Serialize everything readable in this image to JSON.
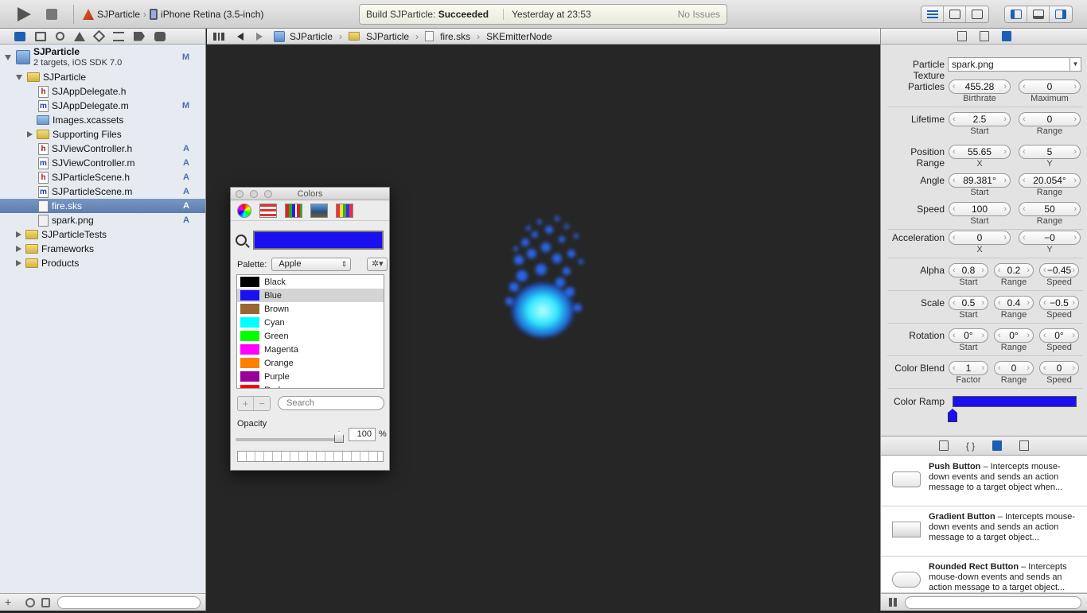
{
  "toolbar": {
    "project": "SJParticle",
    "destination": "iPhone Retina (3.5-inch)",
    "status_prefix": "Build SJParticle:",
    "status_result": "Succeeded",
    "status_time": "Yesterday at 23:53",
    "issues": "No Issues"
  },
  "navigator": {
    "project_name": "SJParticle",
    "project_sub": "2 targets, iOS SDK 7.0",
    "project_badge": "M",
    "rows": [
      {
        "label": "SJParticle",
        "badge": ""
      },
      {
        "label": "SJAppDelegate.h",
        "badge": ""
      },
      {
        "label": "SJAppDelegate.m",
        "badge": "M"
      },
      {
        "label": "Images.xcassets",
        "badge": ""
      },
      {
        "label": "Supporting Files",
        "badge": ""
      },
      {
        "label": "SJViewController.h",
        "badge": "A"
      },
      {
        "label": "SJViewController.m",
        "badge": "A"
      },
      {
        "label": "SJParticleScene.h",
        "badge": "A"
      },
      {
        "label": "SJParticleScene.m",
        "badge": "A"
      },
      {
        "label": "fire.sks",
        "badge": "A"
      },
      {
        "label": "spark.png",
        "badge": "A"
      },
      {
        "label": "SJParticleTests",
        "badge": ""
      },
      {
        "label": "Frameworks",
        "badge": ""
      },
      {
        "label": "Products",
        "badge": ""
      }
    ]
  },
  "jumpbar": {
    "crumbs": [
      "SJParticle",
      "SJParticle",
      "fire.sks",
      "SKEmitterNode"
    ]
  },
  "colors_panel": {
    "title": "Colors",
    "selected_color": "#1a10f0",
    "palette_label": "Palette:",
    "palette_value": "Apple",
    "colors": [
      {
        "name": "Black",
        "hex": "#000000"
      },
      {
        "name": "Blue",
        "hex": "#1a10f0"
      },
      {
        "name": "Brown",
        "hex": "#996633"
      },
      {
        "name": "Cyan",
        "hex": "#00ffff"
      },
      {
        "name": "Green",
        "hex": "#00ff00"
      },
      {
        "name": "Magenta",
        "hex": "#ff00ff"
      },
      {
        "name": "Orange",
        "hex": "#ff8000"
      },
      {
        "name": "Purple",
        "hex": "#990099"
      },
      {
        "name": "Red",
        "hex": "#ff0000"
      }
    ],
    "search_placeholder": "Search",
    "opacity_label": "Opacity",
    "opacity_value": "100",
    "opacity_unit": "%",
    "opacity_fraction": 1.0
  },
  "inspector": {
    "texture_label": "Particle Texture",
    "texture_value": "spark.png",
    "props": [
      {
        "label": "Particles",
        "values": [
          "455.28",
          "0"
        ],
        "subs": [
          "Birthrate",
          "Maximum"
        ]
      },
      {
        "label": "Lifetime",
        "values": [
          "2.5",
          "0"
        ],
        "subs": [
          "Start",
          "Range"
        ]
      },
      {
        "label": "Position Range",
        "values": [
          "55.65",
          "5"
        ],
        "subs": [
          "X",
          "Y"
        ]
      },
      {
        "label": "Angle",
        "values": [
          "89.381°",
          "20.054°"
        ],
        "subs": [
          "Start",
          "Range"
        ]
      },
      {
        "label": "Speed",
        "values": [
          "100",
          "50"
        ],
        "subs": [
          "Start",
          "Range"
        ]
      },
      {
        "label": "Acceleration",
        "values": [
          "0",
          "−0"
        ],
        "subs": [
          "X",
          "Y"
        ]
      },
      {
        "label": "Alpha",
        "values": [
          "0.8",
          "0.2",
          "−0.45"
        ],
        "subs": [
          "Start",
          "Range",
          "Speed"
        ]
      },
      {
        "label": "Scale",
        "values": [
          "0.5",
          "0.4",
          "−0.5"
        ],
        "subs": [
          "Start",
          "Range",
          "Speed"
        ]
      },
      {
        "label": "Rotation",
        "values": [
          "0°",
          "0°",
          "0°"
        ],
        "subs": [
          "Start",
          "Range",
          "Speed"
        ]
      },
      {
        "label": "Color Blend",
        "values": [
          "1",
          "0",
          "0"
        ],
        "subs": [
          "Factor",
          "Range",
          "Speed"
        ]
      }
    ],
    "ramp_label": "Color Ramp"
  },
  "library": {
    "items": [
      {
        "title": "Push Button",
        "desc": " – Intercepts mouse-down events and sends an action message to a target object when..."
      },
      {
        "title": "Gradient Button",
        "desc": " – Intercepts mouse-down events and sends an action message to a target object..."
      },
      {
        "title": "Rounded Rect Button",
        "desc": " – Intercepts mouse-down events and sends an action message to a target object..."
      }
    ]
  }
}
